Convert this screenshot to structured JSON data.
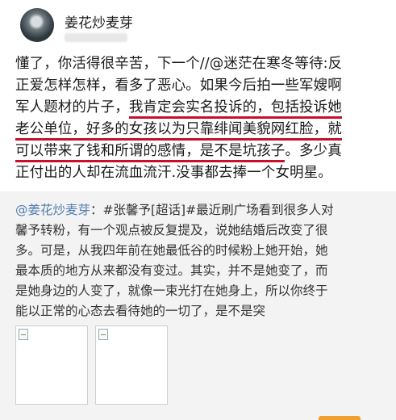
{
  "user": {
    "name": "姜花炒麦芽"
  },
  "post": {
    "line1": "懂了，你活得很辛苦，下一个//@迷茫在寒冬等待:反",
    "line2": "正爱怎样怎样，看多了恶心。如果今后拍一些军嫂啊",
    "line3_pre": "军人题材的片子，",
    "line3_hl": "我肯定会实名投诉的，包括投诉她",
    "line4_hl": "老公单位，好多的女孩以为只靠绯闻美貌网红脸，就",
    "line5_hl": "可以带来了钱和所谓的感情，是不是坑孩子",
    "line5_post": "。多少真",
    "line6": "正付出的人却在流血流汗.没事都去捧一个女明星。"
  },
  "quote": {
    "mention": "@姜花炒麦芽",
    "line1_rest": "：#张馨予[超话]#最近刷广场看到很多人对",
    "line2": "馨予转粉，有一个观点被反复提及，说她结婚后改变了很",
    "line3": "多。可是，从我四年前在她最低谷的时候粉上她开始，她",
    "line4": "最本质的地方从来都没有变过。其实，并不是她变了，而",
    "line5": "是她身边的人变了，就像一束光打在她身上，所以你终于",
    "line6": "能以正常的心态去看待她的一切了，是不是突"
  },
  "colors": {
    "underline": "#c8102e",
    "mention": "#507daf",
    "quote_bg": "#f3f3f3"
  },
  "icons": [
    "broken-image-icon",
    "broken-image-icon"
  ]
}
